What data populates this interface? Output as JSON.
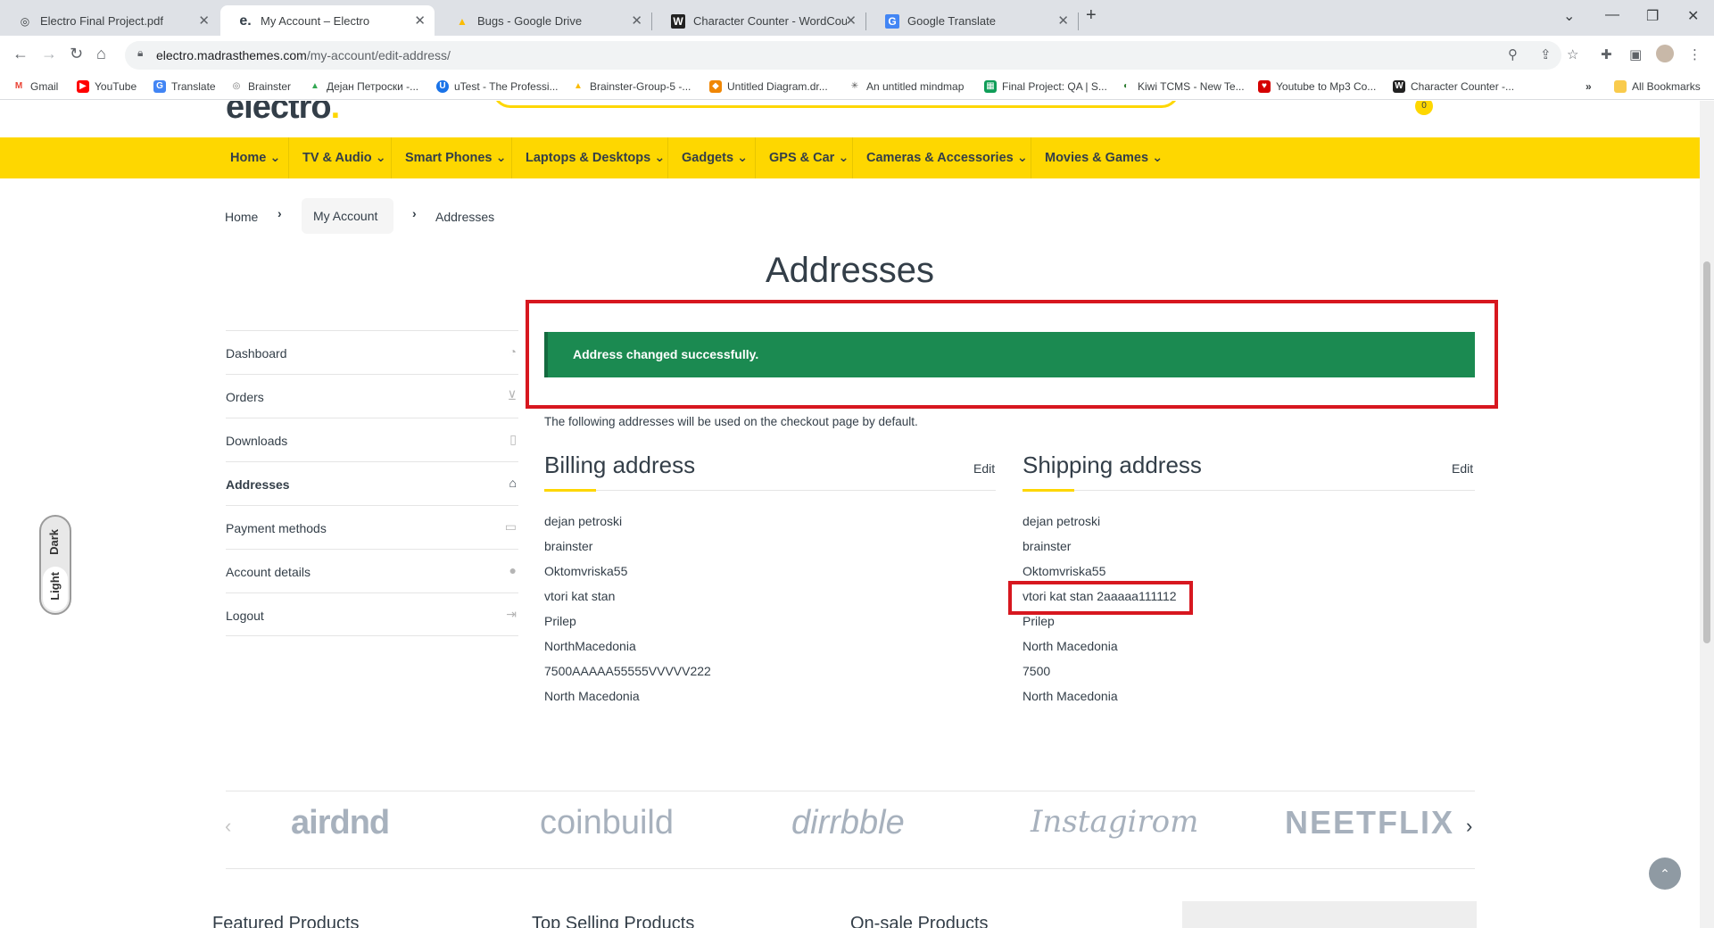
{
  "browser": {
    "tabs": [
      {
        "label": "Electro Final Project.pdf",
        "icon": "pdf-icon"
      },
      {
        "label": "My Account – Electro",
        "icon": "electro-icon",
        "active": true
      },
      {
        "label": "Bugs - Google Drive",
        "icon": "drive-icon"
      },
      {
        "label": "Character Counter - WordCount",
        "icon": "wordcounter-icon"
      },
      {
        "label": "Google Translate",
        "icon": "translate-icon"
      }
    ],
    "url_domain": "electro.madrasthemes.com",
    "url_path": "/my-account/edit-address/",
    "bookmarks": [
      {
        "label": "Gmail",
        "color": "#ea4335",
        "glyph": "M"
      },
      {
        "label": "YouTube",
        "color": "#ff0000",
        "glyph": "▶"
      },
      {
        "label": "Translate",
        "color": "#4285f4",
        "glyph": "G"
      },
      {
        "label": "Brainster",
        "color": "#777777",
        "glyph": "◎"
      },
      {
        "label": "Дејан Петроски -...",
        "color": "#34a853",
        "glyph": "▲"
      },
      {
        "label": "uTest - The Professi...",
        "color": "#1a73e8",
        "glyph": "U"
      },
      {
        "label": "Brainster-Group-5 -...",
        "color": "#fbbc04",
        "glyph": "▲"
      },
      {
        "label": "Untitled Diagram.dr...",
        "color": "#f08705",
        "glyph": "◆"
      },
      {
        "label": "An untitled mindmap",
        "color": "#555555",
        "glyph": "✳"
      },
      {
        "label": "Final Project: QA | S...",
        "color": "#0f9d58",
        "glyph": "▦"
      },
      {
        "label": "Kiwi TCMS - New Te...",
        "color": "#2e7d32",
        "glyph": "◐"
      },
      {
        "label": "Youtube to Mp3 Co...",
        "color": "#d50000",
        "glyph": "♥"
      },
      {
        "label": "Character Counter -...",
        "color": "#222222",
        "glyph": "W"
      }
    ],
    "all_bookmarks": "All Bookmarks"
  },
  "site": {
    "cart_count": "0",
    "nav": [
      "Home",
      "TV & Audio",
      "Smart Phones",
      "Laptops & Desktops",
      "Gadgets",
      "GPS & Car",
      "Cameras & Accessories",
      "Movies & Games"
    ],
    "breadcrumb": {
      "home": "Home",
      "account": "My Account",
      "current": "Addresses"
    },
    "page_title": "Addresses",
    "sidebar": [
      {
        "label": "Dashboard",
        "icon": "dashboard-icon"
      },
      {
        "label": "Orders",
        "icon": "basket-icon"
      },
      {
        "label": "Downloads",
        "icon": "file-icon"
      },
      {
        "label": "Addresses",
        "icon": "home-icon",
        "active": true
      },
      {
        "label": "Payment methods",
        "icon": "card-icon"
      },
      {
        "label": "Account details",
        "icon": "user-icon"
      },
      {
        "label": "Logout",
        "icon": "signout-icon"
      }
    ],
    "notice": "Address changed successfully.",
    "intro": "The following addresses will be used on the checkout page by default.",
    "billing": {
      "title": "Billing address",
      "edit": "Edit",
      "lines": [
        "dejan petroski",
        "brainster",
        "Oktomvriska55",
        "vtori kat stan",
        "Prilep",
        "NorthMacedonia",
        "7500AAAAA55555VVVVV222",
        "North Macedonia"
      ]
    },
    "shipping": {
      "title": "Shipping address",
      "edit": "Edit",
      "lines": [
        "dejan petroski",
        "brainster",
        "Oktomvriska55",
        "vtori kat stan 2aaaaa111112",
        "Prilep",
        "North Macedonia",
        "7500",
        "North Macedonia"
      ]
    },
    "brands": [
      "airdnd",
      "coinbuild",
      "dirrbble",
      "Instagirom",
      "NEETFLIX"
    ],
    "theme_toggle": {
      "dark": "Dark",
      "light": "Light"
    },
    "footer_cols": [
      "Featured Products",
      "Top Selling Products",
      "On-sale Products"
    ],
    "colors": {
      "accent": "#fed700",
      "success": "#1b8a51",
      "highlight": "#d7171f"
    }
  }
}
